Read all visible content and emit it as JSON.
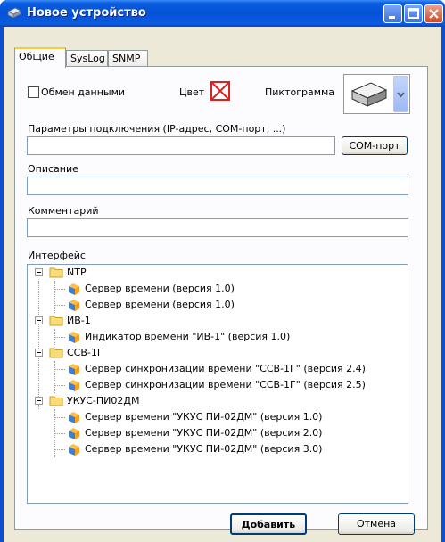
{
  "window": {
    "title": "Новое устройство"
  },
  "tabs": [
    {
      "label": "Общие"
    },
    {
      "label": "SysLog"
    },
    {
      "label": "SNMP"
    }
  ],
  "general": {
    "exchange_label": "Обмен данными",
    "exchange_checked": false,
    "color_label": "Цвет",
    "pictogram_label": "Пиктограмма",
    "connection_label": "Параметры подключения (IP-адрес, COM-порт, ...)",
    "connection_value": "",
    "com_button": "COM-порт",
    "description_label": "Описание",
    "description_value": "",
    "comment_label": "Комментарий",
    "comment_value": "",
    "interface_label": "Интерфейс"
  },
  "tree": [
    {
      "group": "NTP",
      "items": [
        "Сервер времени (версия 1.0)",
        "Сервер времени (версия 1.0)"
      ]
    },
    {
      "group": "ИВ-1",
      "items": [
        "Индикатор времени \"ИВ-1\" (версия 1.0)"
      ]
    },
    {
      "group": "ССВ-1Г",
      "items": [
        "Сервер синхронизации времени \"ССВ-1Г\" (версия 2.4)",
        "Сервер синхронизации времени \"ССВ-1Г\" (версия 2.5)"
      ]
    },
    {
      "group": "УКУС-ПИ02ДМ",
      "items": [
        "Сервер времени \"УКУС ПИ-02ДМ\" (версия 1.0)",
        "Сервер времени \"УКУС ПИ-02ДМ\" (версия 2.0)",
        "Сервер времени \"УКУС ПИ-02ДМ\" (версия 3.0)"
      ]
    }
  ],
  "buttons": {
    "add": "Добавить",
    "cancel": "Отмена"
  },
  "colors": {
    "titlebar": "#0551d8",
    "dialog": "#ece9d8",
    "color_swatch": "#e02020",
    "active_tab": "#ffc83c"
  }
}
